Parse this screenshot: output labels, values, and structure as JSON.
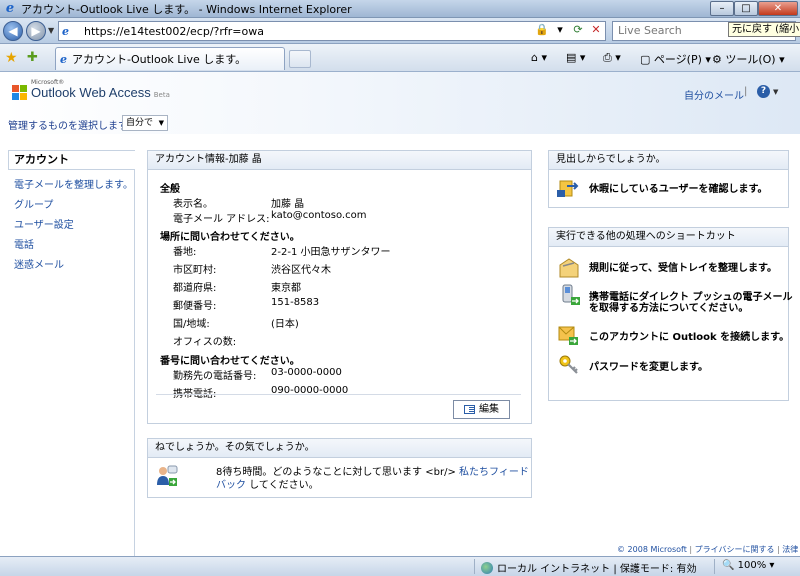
{
  "window": {
    "title": "アカウント-Outlook Live します。 - Windows Internet Explorer",
    "restore_tooltip": "元に戻す (縮小)"
  },
  "address_bar": {
    "url": "https://e14test002/ecp/?rfr=owa",
    "search_placeholder": "Live Search"
  },
  "tab": {
    "label": "アカウント-Outlook Live します。"
  },
  "command_bar": {
    "page_menu": "ページ(P)",
    "tools_menu": "ツール(O)"
  },
  "header": {
    "logo_ms": "Microsoft®",
    "logo_text": "Outlook Web Access",
    "logo_beta": "Beta",
    "my_mail_link": "自分のメール",
    "separator": "|",
    "manage_label": "管理するものを選択します。",
    "manage_select_value": "自分で"
  },
  "leftnav": {
    "active": "アカウント",
    "items": [
      "電子メールを整理します。",
      "グループ",
      "ユーザー設定",
      "電話",
      "迷惑メール"
    ]
  },
  "account_panel": {
    "title": "アカウント情報-加藤 晶",
    "sections": [
      {
        "title": "全般",
        "fields": [
          {
            "label": "表示名。",
            "value": "加藤 晶"
          },
          {
            "label": "電子メール アドレス:",
            "value": "kato@contoso.com"
          }
        ]
      },
      {
        "title": "場所に問い合わせてください。",
        "fields": [
          {
            "label": "番地:",
            "value": "2-2-1 小田急サザンタワー"
          },
          {
            "label": "市区町村:",
            "value": "渋谷区代々木"
          },
          {
            "label": "都道府県:",
            "value": "東京都"
          },
          {
            "label": "郵便番号:",
            "value": "151-8583"
          },
          {
            "label": "国/地域:",
            "value": "(日本)"
          },
          {
            "label": "オフィスの数:",
            "value": ""
          }
        ]
      },
      {
        "title": "番号に問い合わせてください。",
        "fields": [
          {
            "label": "勤務先の電話番号:",
            "value": "03-0000-0000"
          },
          {
            "label": "携帯電話:",
            "value": "090-0000-0000"
          }
        ]
      }
    ],
    "edit_button": "編集"
  },
  "feedback_panel": {
    "title": "ねでしょうか。その気でしょうか。",
    "text": "8待ち時間。どのようなことに対して思います <br/> ",
    "link": "私たちフィードバック",
    "text_after": " してください。"
  },
  "lookup_panel": {
    "title": "見出しからでしょうか。",
    "action": "休暇にしているユーザーを確認します。"
  },
  "shortcuts_panel": {
    "title": "実行できる他の処理へのショートカット",
    "items": [
      {
        "line1": "規則に従って、受信トレイを整理します。",
        "line2": ""
      },
      {
        "line1": "携帯電話にダイレクト プッシュの電子メール",
        "line2": "を取得する方法についてください。"
      },
      {
        "line1": "このアカウントに Outlook を接続します。",
        "line2": ""
      },
      {
        "line1": "パスワードを変更します。",
        "line2": ""
      }
    ]
  },
  "footer": {
    "copyright": "© 2008 Microsoft",
    "privacy": "プライバシーに関する",
    "legal": "法律"
  },
  "status_bar": {
    "zone": "ローカル イントラネット | 保護モード: 有効",
    "zoom": "100%"
  },
  "colors": {
    "link": "#1f4fa0",
    "panel_border": "#c3cfde",
    "header_gradient_end": "#dde8f5"
  }
}
